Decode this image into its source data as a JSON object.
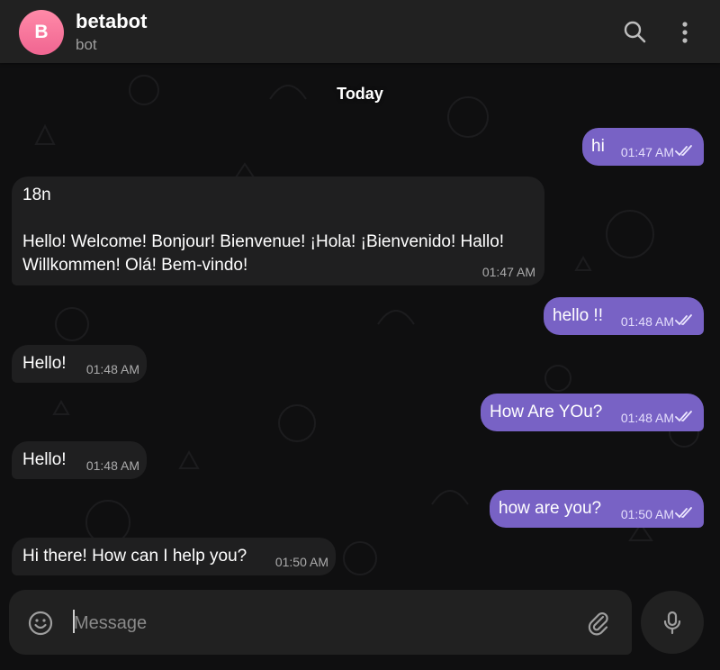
{
  "chat": {
    "title": "betabot",
    "subtitle": "bot",
    "avatar_letter": "B"
  },
  "date_separator": "Today",
  "messages": [
    {
      "direction": "out",
      "text": "hi",
      "time": "01:47 AM",
      "status": "read"
    },
    {
      "direction": "in",
      "text": "18n\n\nHello! Welcome! Bonjour! Bienvenue! ¡Hola! ¡Bienvenido! Hallo!\nWillkommen! Olá! Bem-vindo!",
      "time": "01:47 AM"
    },
    {
      "direction": "out",
      "text": "hello !!",
      "time": "01:48 AM",
      "status": "read"
    },
    {
      "direction": "in",
      "text": "Hello!",
      "time": "01:48 AM"
    },
    {
      "direction": "out",
      "text": "How Are YOu?",
      "time": "01:48 AM",
      "status": "read"
    },
    {
      "direction": "in",
      "text": "Hello!",
      "time": "01:48 AM"
    },
    {
      "direction": "out",
      "text": "how are you?",
      "time": "01:50 AM",
      "status": "read"
    },
    {
      "direction": "in",
      "text": "Hi there! How can I help you?",
      "time": "01:50 AM"
    }
  ],
  "composer": {
    "placeholder": "Message",
    "value": ""
  },
  "icons": {
    "search": "search-icon",
    "menu": "more-vertical-icon",
    "emoji": "emoji-icon",
    "attach": "paperclip-icon",
    "mic": "microphone-icon",
    "read": "double-check-icon"
  },
  "colors": {
    "accent": "#7862c5",
    "incoming_bubble": "#1f1f20",
    "header": "#212121",
    "background": "#0f0f10",
    "avatar": "#f06591"
  }
}
